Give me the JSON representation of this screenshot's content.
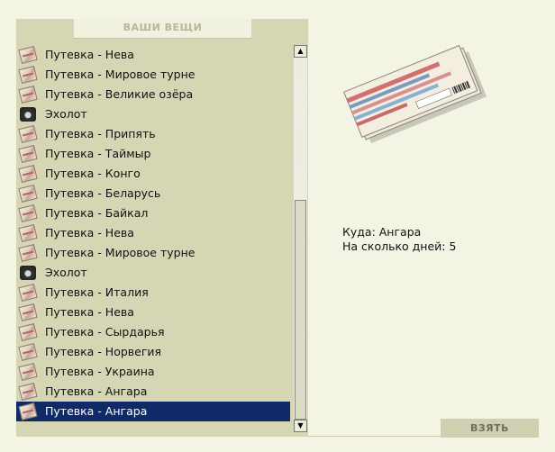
{
  "panel": {
    "title": "ВАШИ ВЕЩИ"
  },
  "items": [
    {
      "label": "Путевка - Нева",
      "icon": "ticket-icon"
    },
    {
      "label": "Путевка - Мировое турне",
      "icon": "ticket-icon"
    },
    {
      "label": "Путевка - Великие озёра",
      "icon": "ticket-icon"
    },
    {
      "label": "Эхолот",
      "icon": "sonar-icon"
    },
    {
      "label": "Путевка - Припять",
      "icon": "ticket-icon"
    },
    {
      "label": "Путевка - Таймыр",
      "icon": "ticket-icon"
    },
    {
      "label": "Путевка - Конго",
      "icon": "ticket-icon"
    },
    {
      "label": "Путевка - Беларусь",
      "icon": "ticket-icon"
    },
    {
      "label": "Путевка - Байкал",
      "icon": "ticket-icon"
    },
    {
      "label": "Путевка - Нева",
      "icon": "ticket-icon"
    },
    {
      "label": "Путевка - Мировое турне",
      "icon": "ticket-icon"
    },
    {
      "label": "Эхолот",
      "icon": "sonar-icon"
    },
    {
      "label": "Путевка - Италия",
      "icon": "ticket-icon"
    },
    {
      "label": "Путевка - Нева",
      "icon": "ticket-icon"
    },
    {
      "label": "Путевка - Сырдарья",
      "icon": "ticket-icon"
    },
    {
      "label": "Путевка - Норвегия",
      "icon": "ticket-icon"
    },
    {
      "label": "Путевка - Украина",
      "icon": "ticket-icon"
    },
    {
      "label": "Путевка - Ангара",
      "icon": "ticket-icon"
    },
    {
      "label": "Путевка - Ангара",
      "icon": "ticket-icon",
      "selected": true
    }
  ],
  "details": {
    "destination_line": "Куда: Ангара",
    "days_line": "На сколько дней: 5"
  },
  "actions": {
    "take_label": "ВЗЯТЬ"
  },
  "scrollbar": {
    "up_glyph": "▲",
    "down_glyph": "▼"
  },
  "colors": {
    "background": "#f4f4e4",
    "panel": "#d6d6b4",
    "selection": "#0f2a66",
    "button": "#d0d0b0"
  }
}
